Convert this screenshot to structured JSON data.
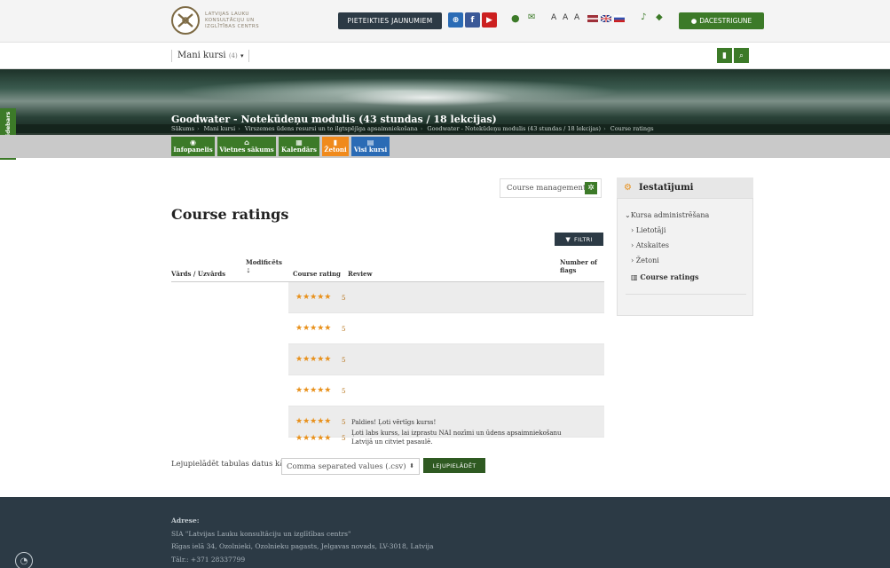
{
  "header": {
    "logo_lines": [
      "LATVIJAS LAUKU",
      "KONSULTĀCIJU UN",
      "IZGLĪTĪBAS CENTRS"
    ],
    "register_button": "PIETEIKTIES JAUNUMIEM",
    "font_size_control": "A A A",
    "user_button": "DACESTRIGUNE",
    "icons": [
      "globe-icon",
      "facebook-icon",
      "youtube-icon",
      "map-pin-icon",
      "envelope-icon",
      "bell-icon",
      "chat-icon",
      "user-icon"
    ]
  },
  "navbar": {
    "my_courses": "Mani kursi",
    "my_courses_count": "(4)",
    "icons": [
      "bookmark-icon",
      "search-icon"
    ]
  },
  "hide_sidebars": "Hide sidebars",
  "course": {
    "title": "Goodwater - Notekūdeņu modulis (43 stundas / 18 lekcijas)"
  },
  "breadcrumb": [
    "Sākums",
    "Mani kursi",
    "Virszemes ūdens resursi un to ilgtspējīga apsaimniekošana",
    "Goodwater - Notekūdeņu modulis (43 stundas / 18 lekcijas)",
    "Course ratings"
  ],
  "tiles": [
    {
      "label": "Infopanelis",
      "icon": "dashboard-icon",
      "color": "#3c7a28"
    },
    {
      "label": "Vietnes sākums",
      "icon": "home-icon",
      "color": "#3c7a28"
    },
    {
      "label": "Kalendārs",
      "icon": "calendar-icon",
      "color": "#3c7a28"
    },
    {
      "label": "Žetoni",
      "icon": "bookmark-icon",
      "color": "#f08a1c"
    },
    {
      "label": "Visi kursi",
      "icon": "courses-icon",
      "color": "#2a6bb5"
    }
  ],
  "course_management": "Course management",
  "page_title": "Course ratings",
  "filter_button": "FILTRI",
  "table": {
    "headers": {
      "name": "Vārds / Uzvārds",
      "modified": "Modificēts",
      "rating": "Course rating",
      "review": "Review",
      "flags": "Number of flags"
    },
    "rows": [
      {
        "stars": "★★★★★",
        "rating": "5",
        "review": ""
      },
      {
        "stars": "★★★★★",
        "rating": "5",
        "review": ""
      },
      {
        "stars": "★★★★★",
        "rating": "5",
        "review": ""
      },
      {
        "stars": "★★★★★",
        "rating": "5",
        "review": ""
      },
      {
        "stars": "★★★★★",
        "rating": "5",
        "review": "Paldies! Ļoti vērtīgs kurss!"
      },
      {
        "stars": "★★★★★",
        "rating": "5",
        "review_line1": "Ļoti labs kurss, lai izprastu NAI nozīmi un ūdens apsaimniekošanu",
        "review_line2": "Latvijā un citviet pasaulē."
      }
    ]
  },
  "download": {
    "label": "Lejupielādēt tabulas datus kā",
    "selected": "Comma separated values (.csv)",
    "button": "LEJUPIELĀDĒT"
  },
  "sidebar": {
    "title": "Iestatījumi",
    "items": {
      "admin": "Kursa administrēšana",
      "users": "Lietotāji",
      "reports": "Atskaites",
      "badges": "Žetoni",
      "ratings": "Course ratings"
    }
  },
  "footer": {
    "address_label": "Adrese:",
    "org": "SIA \"Latvijas Lauku konsultāciju un izglītības centrs\"",
    "street": "Rīgas ielā 34, Ozolnieki, Ozolnieku pagasts, Jelgavas novads, LV-3018, Latvija",
    "phone": "Tālr.: +371 28337799"
  },
  "colors": {
    "brand_green": "#3c7a28",
    "dark": "#2c3a45",
    "star": "#e8901a"
  }
}
